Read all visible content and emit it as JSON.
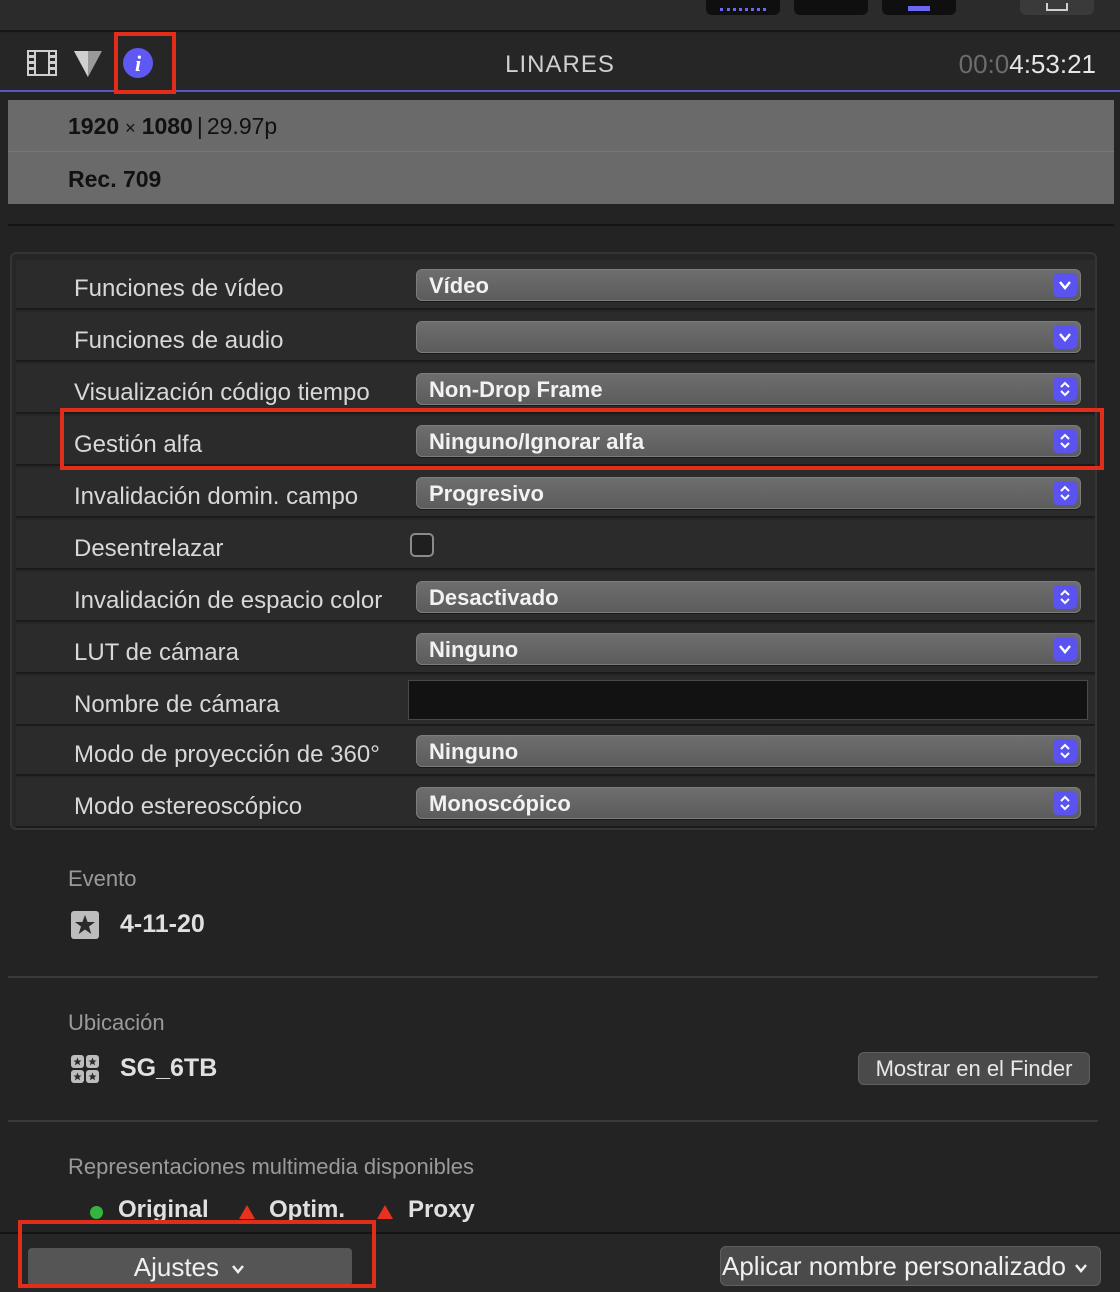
{
  "inspector": {
    "title": "LINARES",
    "timecode_dim": "00:0",
    "timecode": "4:53:21"
  },
  "summary": {
    "width": "1920",
    "times": "×",
    "height": "1080",
    "rate": "29.97p",
    "color_space": "Rec. 709"
  },
  "settings": [
    {
      "label": "Funciones de vídeo",
      "value": "Vídeo",
      "control": "popup-down"
    },
    {
      "label": "Funciones de audio",
      "value": "",
      "control": "popup-down"
    },
    {
      "label": "Visualización código tiempo",
      "value": "Non-Drop Frame",
      "control": "popup-updown"
    },
    {
      "label": "Gestión alfa",
      "value": "Ninguno/Ignorar alfa",
      "control": "popup-updown"
    },
    {
      "label": "Invalidación domin. campo",
      "value": "Progresivo",
      "control": "popup-updown"
    },
    {
      "label": "Desentrelazar",
      "value": "",
      "control": "checkbox"
    },
    {
      "label": "Invalidación de espacio color",
      "value": "Desactivado",
      "control": "popup-updown"
    },
    {
      "label": "LUT de cámara",
      "value": "Ninguno",
      "control": "popup-down"
    },
    {
      "label": "Nombre de cámara",
      "value": "",
      "control": "text"
    },
    {
      "label": "Modo de proyección de 360°",
      "value": "Ninguno",
      "control": "popup-updown"
    },
    {
      "label": "Modo estereoscópico",
      "value": "Monoscópico",
      "control": "popup-updown"
    }
  ],
  "event": {
    "label": "Evento",
    "value": "4-11-20",
    "icon": "star-event-icon"
  },
  "location": {
    "label": "Ubicación",
    "value": "SG_6TB",
    "icon": "library-icon",
    "button": "Mostrar en el Finder"
  },
  "media": {
    "label": "Representaciones multimedia disponibles",
    "items": [
      {
        "name": "Original",
        "status": "available",
        "color": "#35b540"
      },
      {
        "name": "Optim.",
        "status": "missing",
        "color": "#e8311f"
      },
      {
        "name": "Proxy",
        "status": "missing",
        "color": "#e8311f"
      }
    ]
  },
  "bottom": {
    "settings_button": "Ajustes",
    "apply_button": "Aplicar nombre personalizado"
  },
  "colors": {
    "accent": "#5b53f0",
    "highlight": "#e22d1a"
  }
}
